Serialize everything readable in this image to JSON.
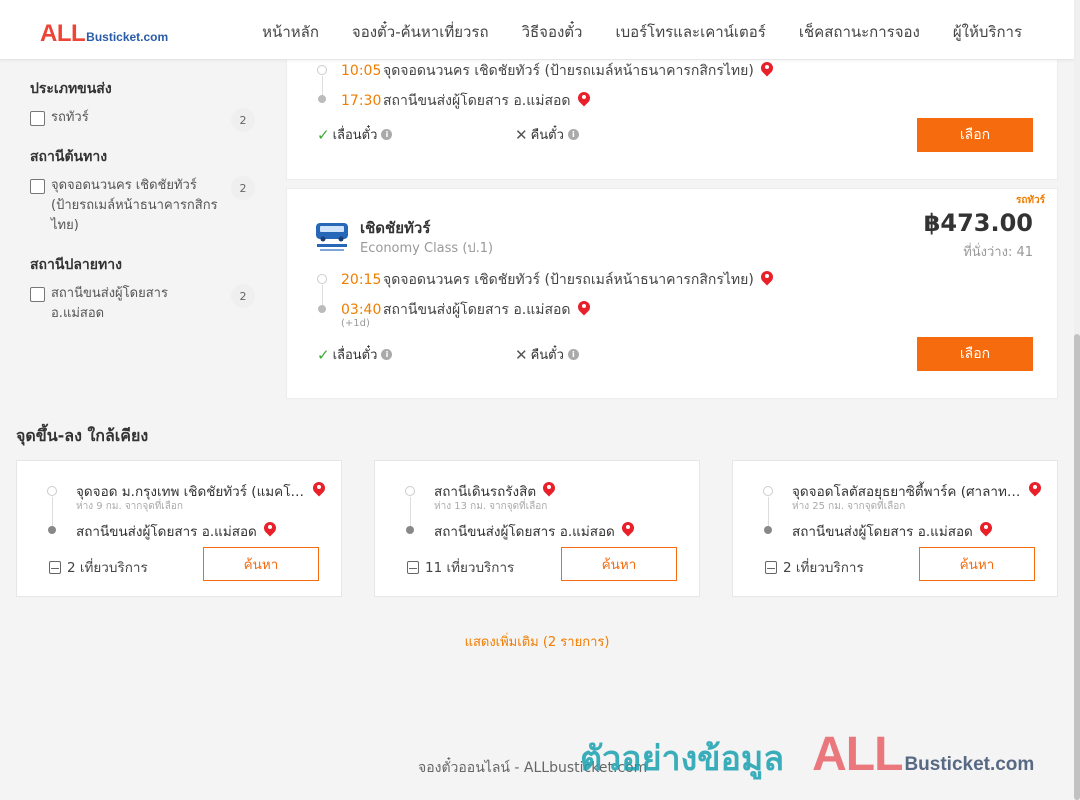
{
  "header": {
    "logo_all": "ALL",
    "logo_busticket": "Busticket.com",
    "nav": [
      "หน้าหลัก",
      "จองตั๋ว-ค้นหาเที่ยวรถ",
      "วิธีจองตั๋ว",
      "เบอร์โทรและเคาน์เตอร์",
      "เช็คสถานะการจอง",
      "ผู้ให้บริการ"
    ]
  },
  "sidebar": {
    "groups": [
      {
        "title": "ประเภทขนส่ง",
        "options": [
          {
            "label": "รถทัวร์",
            "count": "2"
          }
        ]
      },
      {
        "title": "สถานีต้นทาง",
        "options": [
          {
            "label": "จุดจอดนวนคร เชิดชัยทัวร์ (ป้ายรถเมล์หน้าธนาคารกสิกรไทย)",
            "count": "2"
          }
        ]
      },
      {
        "title": "สถานีปลายทาง",
        "options": [
          {
            "label": "สถานีขนส่งผู้โดยสาร อ.แม่สอด",
            "count": "2"
          }
        ]
      }
    ]
  },
  "trips": [
    {
      "depart_time": "10:05",
      "depart_place": "จุดจอดนวนคร เชิดชัยทัวร์ (ป้ายรถเมล์หน้าธนาคารกสิกรไทย)",
      "arrive_time": "17:30",
      "arrive_place": "สถานีขนส่งผู้โดยสาร อ.แม่สอด",
      "reschedule": "เลื่อนตั๋ว",
      "refund": "คืนตั๋ว",
      "select_label": "เลือก"
    },
    {
      "bus_type": "รถทัวร์",
      "operator": "เชิดชัยทัวร์",
      "class": "Economy Class (ป.1)",
      "price": "฿473.00",
      "seats": "ที่นั่งว่าง: 41",
      "depart_time": "20:15",
      "depart_place": "จุดจอดนวนคร เชิดชัยทัวร์ (ป้ายรถเมล์หน้าธนาคารกสิกรไทย)",
      "arrive_time": "03:40",
      "arrive_next_day": "(+1d)",
      "arrive_place": "สถานีขนส่งผู้โดยสาร อ.แม่สอด",
      "reschedule": "เลื่อนตั๋ว",
      "refund": "คืนตั๋ว",
      "select_label": "เลือก"
    }
  ],
  "nearby": {
    "title": "จุดขึ้น-ลง ใกล้เคียง",
    "cards": [
      {
        "from": "จุดจอด ม.กรุงเทพ เชิดชัยทัวร์ (แมคโคร รังสิต)",
        "distance": "ห่าง 9 กม. จากจุดที่เลือก",
        "to": "สถานีขนส่งผู้โดยสาร อ.แม่สอด",
        "trips": "2 เที่ยวบริการ",
        "search_label": "ค้นหา"
      },
      {
        "from": "สถานีเดินรถรังสิต",
        "distance": "ห่าง 13 กม. จากจุดที่เลือก",
        "to": "สถานีขนส่งผู้โดยสาร อ.แม่สอด",
        "trips": "11 เที่ยวบริการ",
        "search_label": "ค้นหา"
      },
      {
        "from": "จุดจอดโลตัสอยุธยาซิตี้พาร์ค (ศาลาทางรถเมล์)",
        "distance": "ห่าง 25 กม. จากจุดที่เลือก",
        "to": "สถานีขนส่งผู้โดยสาร อ.แม่สอด",
        "trips": "2 เที่ยวบริการ",
        "search_label": "ค้นหา"
      }
    ],
    "show_more": "แสดงเพิ่มเติม (2 รายการ)"
  },
  "footer": {
    "text": "จองตั๋วออนไลน์ - ALLbusticket.com"
  },
  "watermark": {
    "thai": "ตัวอย่างข้อมูล",
    "all": "ALL",
    "busticket": "Busticket.com"
  },
  "colors": {
    "accent": "#f66b0e",
    "time": "#f07d00",
    "pin": "#e8202a",
    "check": "#3aa835"
  }
}
